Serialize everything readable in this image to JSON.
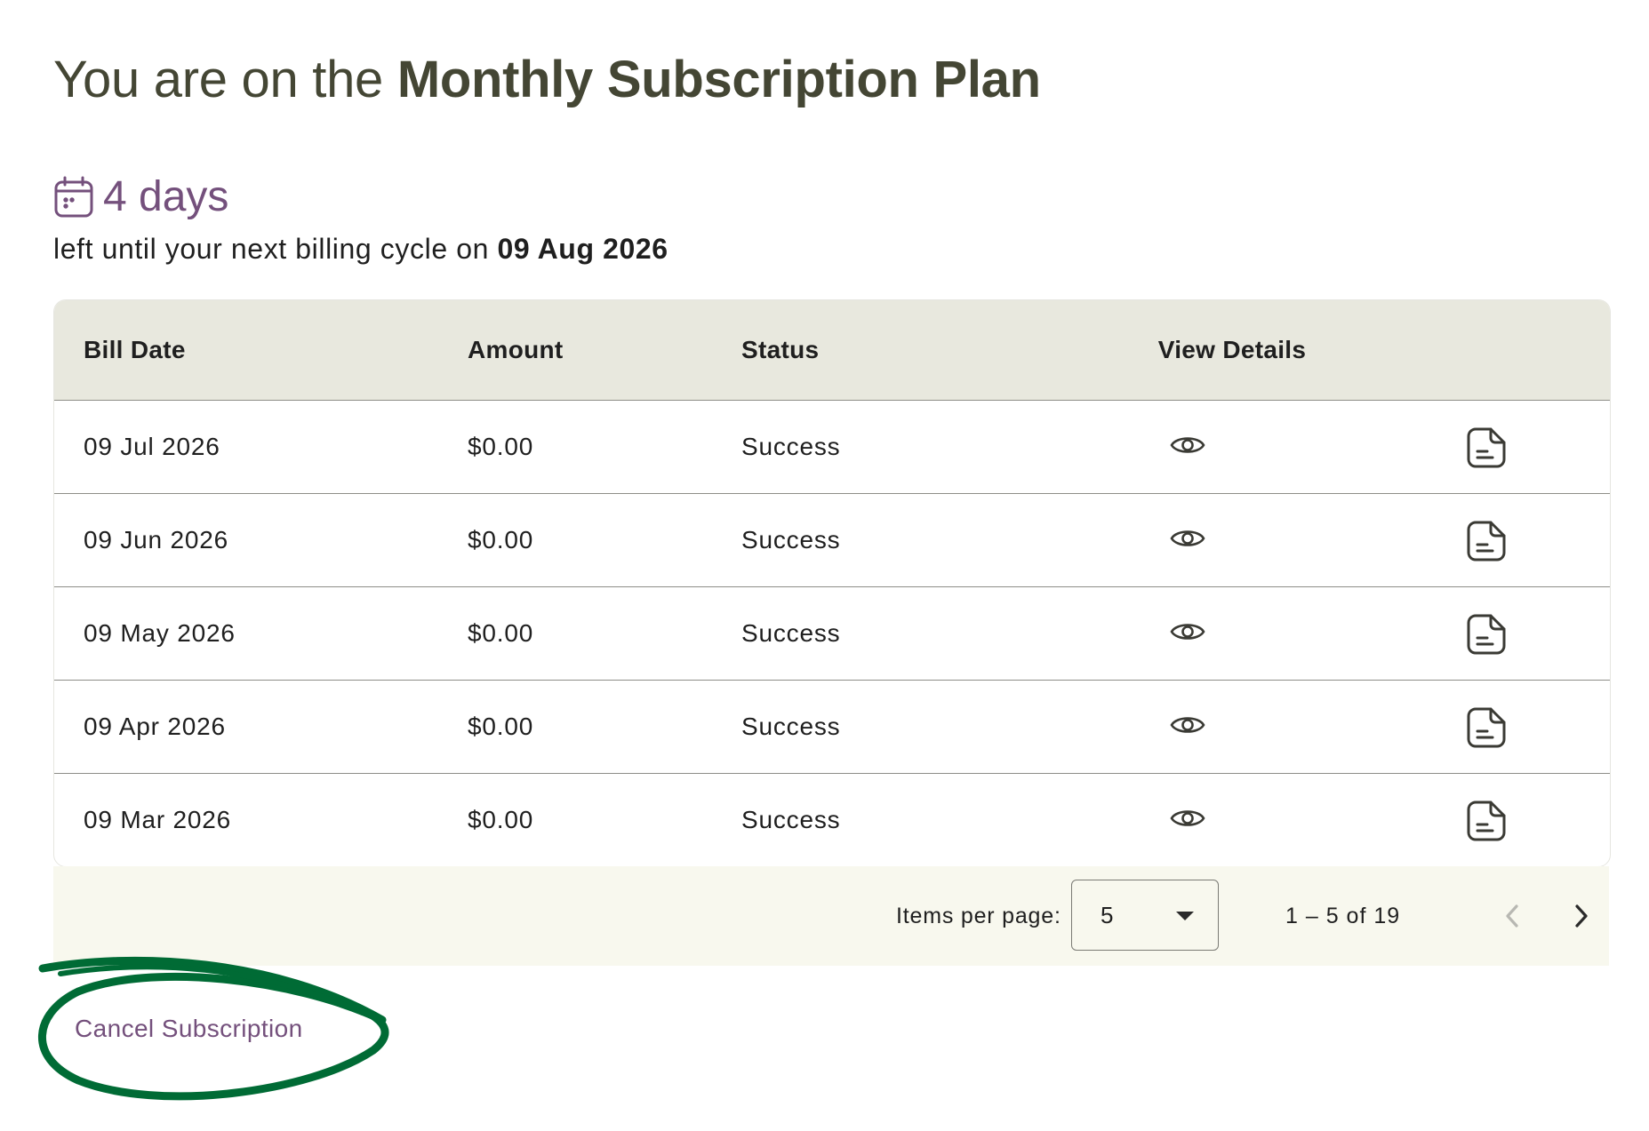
{
  "header": {
    "title_prefix": "You are on the ",
    "plan_name": "Monthly Subscription Plan"
  },
  "billing": {
    "days_left": "4 days",
    "cycle_text": "left until your next billing cycle on ",
    "next_date": "09 Aug 2026"
  },
  "table": {
    "columns": [
      "Bill Date",
      "Amount",
      "Status",
      "View Details",
      ""
    ],
    "rows": [
      {
        "date": "09 Jul 2026",
        "amount": "$0.00",
        "status": "Success"
      },
      {
        "date": "09 Jun 2026",
        "amount": "$0.00",
        "status": "Success"
      },
      {
        "date": "09 May 2026",
        "amount": "$0.00",
        "status": "Success"
      },
      {
        "date": "09 Apr 2026",
        "amount": "$0.00",
        "status": "Success"
      },
      {
        "date": "09 Mar 2026",
        "amount": "$0.00",
        "status": "Success"
      }
    ],
    "icons": {
      "view": "eye-icon",
      "invoice": "document-icon"
    }
  },
  "paginator": {
    "items_per_page_label": "Items per page:",
    "items_per_page_value": "5",
    "range_label": "1 – 5 of 19"
  },
  "actions": {
    "cancel_label": "Cancel Subscription"
  },
  "colors": {
    "accent": "#74507c",
    "title": "#444634",
    "header_bg": "#e8e8de",
    "paginator_bg": "#f8f8ee",
    "annotation": "#006b35"
  }
}
